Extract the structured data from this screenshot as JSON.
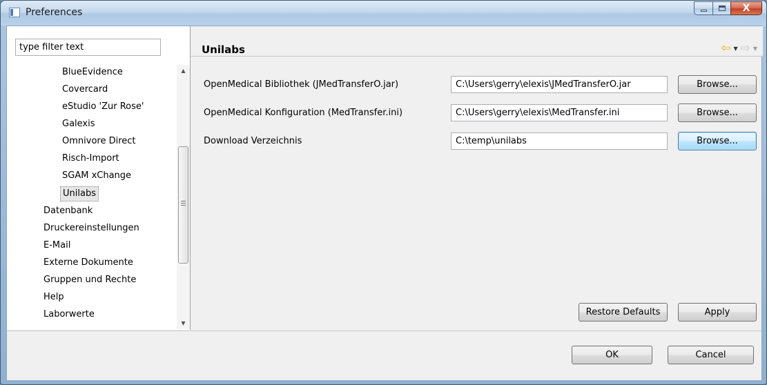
{
  "window": {
    "title": "Preferences",
    "close_glyph": "X"
  },
  "filter": {
    "value": "type filter text"
  },
  "tree": {
    "items": [
      {
        "label": "BlueEvidence",
        "level": 2
      },
      {
        "label": "Covercard",
        "level": 2
      },
      {
        "label": "eStudio 'Zur Rose'",
        "level": 2
      },
      {
        "label": "Galexis",
        "level": 2
      },
      {
        "label": "Omnivore Direct",
        "level": 2
      },
      {
        "label": "Risch-Import",
        "level": 2
      },
      {
        "label": "SGAM xChange",
        "level": 2
      },
      {
        "label": "Unilabs",
        "level": 2,
        "selected": true
      },
      {
        "label": "Datenbank",
        "level": 1
      },
      {
        "label": "Druckereinstellungen",
        "level": 1
      },
      {
        "label": "E-Mail",
        "level": 1
      },
      {
        "label": "Externe Dokumente",
        "level": 1
      },
      {
        "label": "Gruppen und Rechte",
        "level": 1
      },
      {
        "label": "Help",
        "level": 1
      },
      {
        "label": "Laborwerte",
        "level": 1
      }
    ]
  },
  "page": {
    "title": "Unilabs",
    "fields": [
      {
        "label": "OpenMedical Bibliothek (JMedTransferO.jar)",
        "value": "C:\\Users\\gerry\\elexis\\JMedTransferO.jar",
        "button": "Browse..."
      },
      {
        "label": "OpenMedical Konfiguration (MedTransfer.ini)",
        "value": "C:\\Users\\gerry\\elexis\\MedTransfer.ini",
        "button": "Browse..."
      },
      {
        "label": "Download Verzeichnis",
        "value": "C:\\temp\\unilabs",
        "button": "Browse..."
      }
    ],
    "restore_defaults": "Restore Defaults",
    "apply": "Apply"
  },
  "dialog": {
    "ok": "OK",
    "cancel": "Cancel"
  },
  "colors": {
    "accent_nav_back": "#e4b312",
    "close_button": "#c1412a"
  }
}
